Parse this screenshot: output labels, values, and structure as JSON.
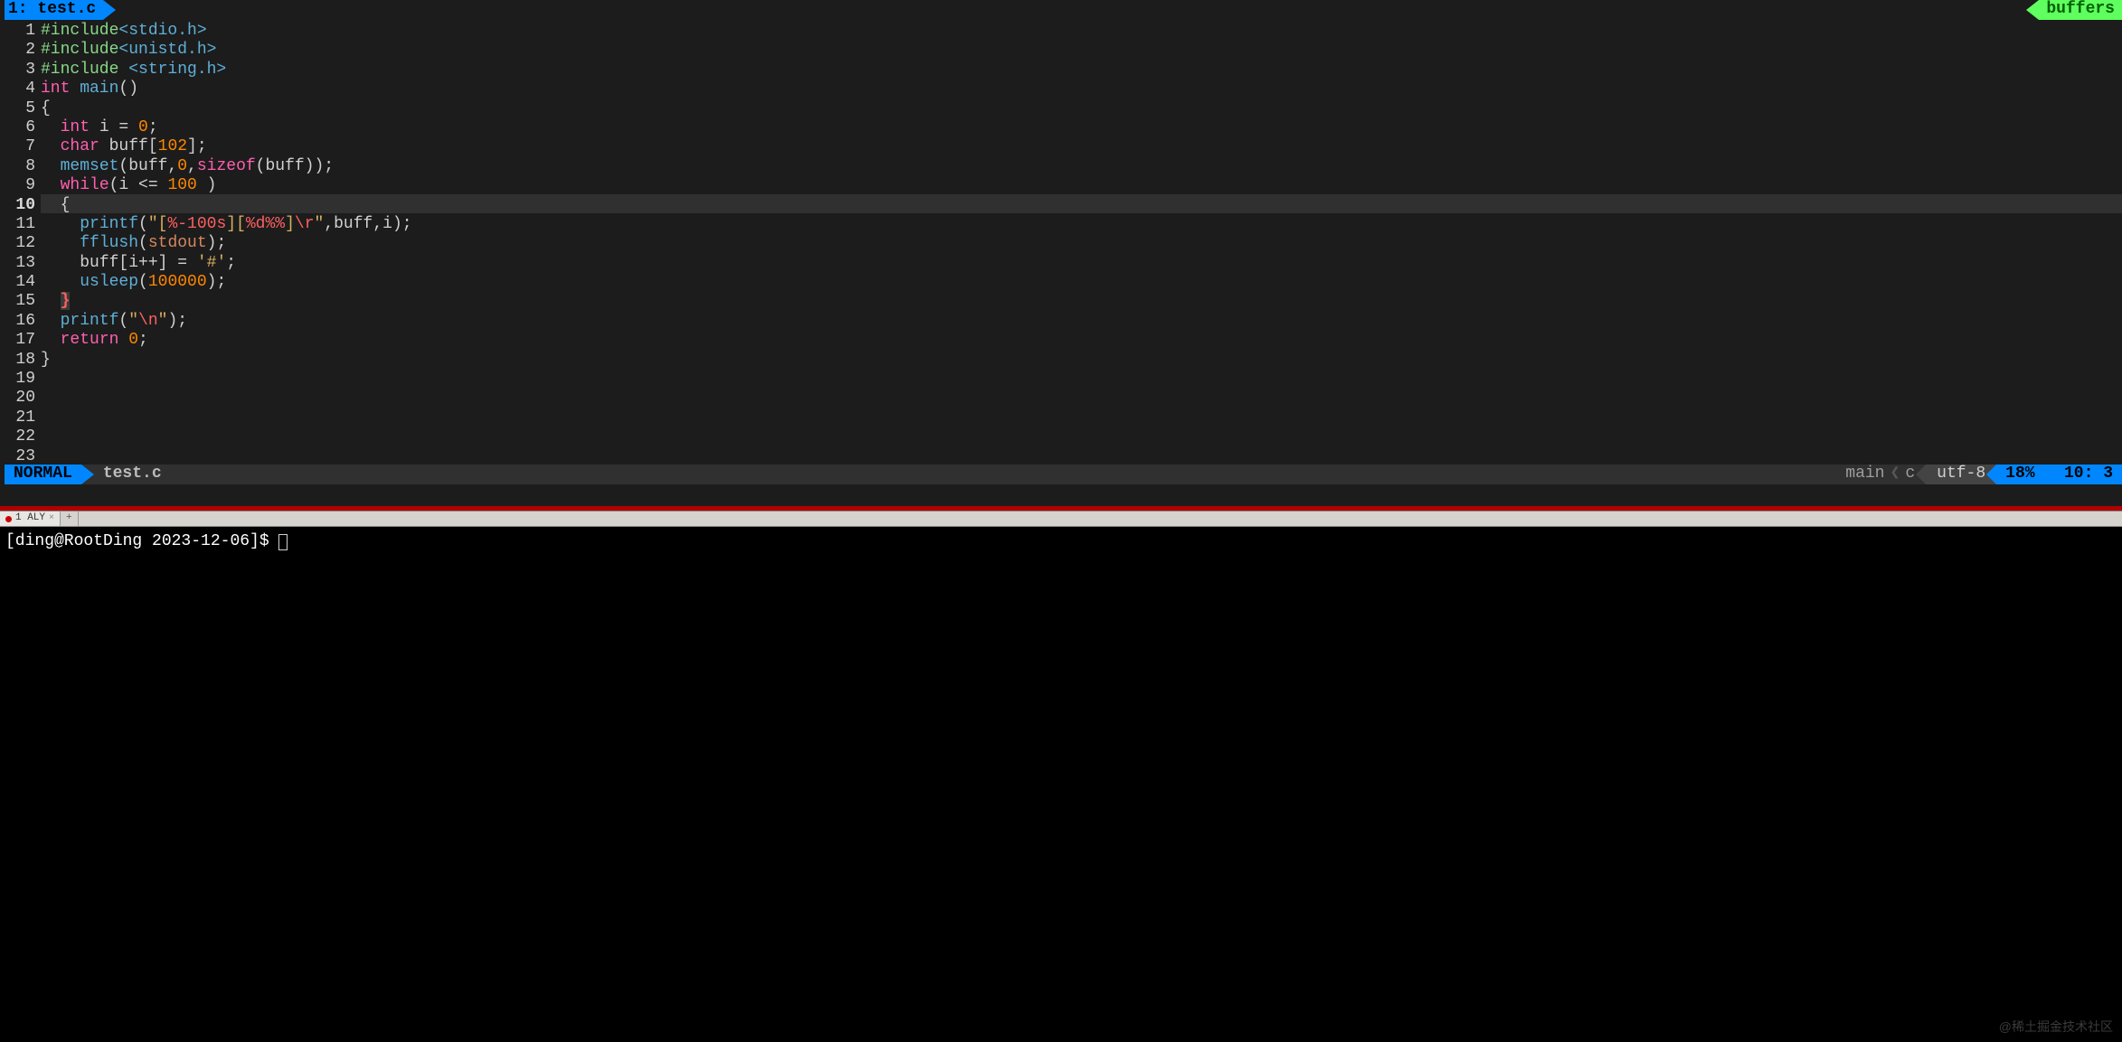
{
  "tab": {
    "label": "1: test.c",
    "buffers_label": "buffers"
  },
  "gutter": [
    "1",
    "2",
    "3",
    "4",
    "5",
    "6",
    "7",
    "8",
    "9",
    "10",
    "11",
    "12",
    "13",
    "14",
    "15",
    "16",
    "17",
    "18",
    "19",
    "20",
    "21",
    "22",
    "23"
  ],
  "current_line_index": 9,
  "code": {
    "l1": {
      "inc": "#include",
      "hdr": "<stdio.h>"
    },
    "l2": {
      "inc": "#include",
      "hdr": "<unistd.h>"
    },
    "l3": {
      "inc": "#include ",
      "hdr": "<string.h>"
    },
    "l4": {
      "type": "int",
      "func": " main",
      "rest": "()"
    },
    "l5": "{",
    "l6": {
      "indent": "  ",
      "type": "int",
      "rest1": " i = ",
      "num": "0",
      "rest2": ";"
    },
    "l7": {
      "indent": "  ",
      "type": "char",
      "rest1": " buff[",
      "num": "102",
      "rest2": "];"
    },
    "l8": {
      "indent": "  ",
      "func": "memset",
      "rest1": "(buff,",
      "num": "0",
      "rest2": ",",
      "kw": "sizeof",
      "rest3": "(buff));"
    },
    "l9": {
      "indent": "  ",
      "kw": "while",
      "rest1": "(i <= ",
      "num": "100",
      "rest2": " )"
    },
    "l10": {
      "indent": "  ",
      "brace": "{"
    },
    "l11": {
      "indent": "    ",
      "func": "printf",
      "rest1": "(",
      "str1": "\"[",
      "esc1": "%-100s",
      "str2": "][",
      "esc2": "%d%%",
      "str3": "]",
      "esc3": "\\r",
      "str4": "\"",
      "rest2": ",buff,i);"
    },
    "l12": {
      "indent": "    ",
      "func": "fflush",
      "rest1": "(",
      "id": "stdout",
      "rest2": ");"
    },
    "l13": {
      "indent": "    ",
      "rest1": "buff[i++] = ",
      "chr": "'#'",
      "rest2": ";"
    },
    "l14": {
      "indent": "    ",
      "func": "usleep",
      "rest1": "(",
      "num": "100000",
      "rest2": ");"
    },
    "l15": {
      "indent": "  ",
      "brace": "}"
    },
    "l16": {
      "indent": "  ",
      "func": "printf",
      "rest1": "(",
      "str1": "\"",
      "esc1": "\\n",
      "str2": "\"",
      "rest2": ");"
    },
    "l17": {
      "indent": "  ",
      "kw": "return",
      "rest1": " ",
      "num": "0",
      "rest2": ";"
    },
    "l18": "}"
  },
  "status": {
    "mode": "NORMAL",
    "file": "test.c",
    "branch": "main",
    "filetype": "c",
    "encoding": "utf-8",
    "percent": "18%",
    "pos": "10:  3"
  },
  "term_tab": {
    "label": "1 ALY",
    "add": "+"
  },
  "prompt": "[ding@RootDing 2023-12-06]$ ",
  "watermark": "@稀土掘金技术社区"
}
